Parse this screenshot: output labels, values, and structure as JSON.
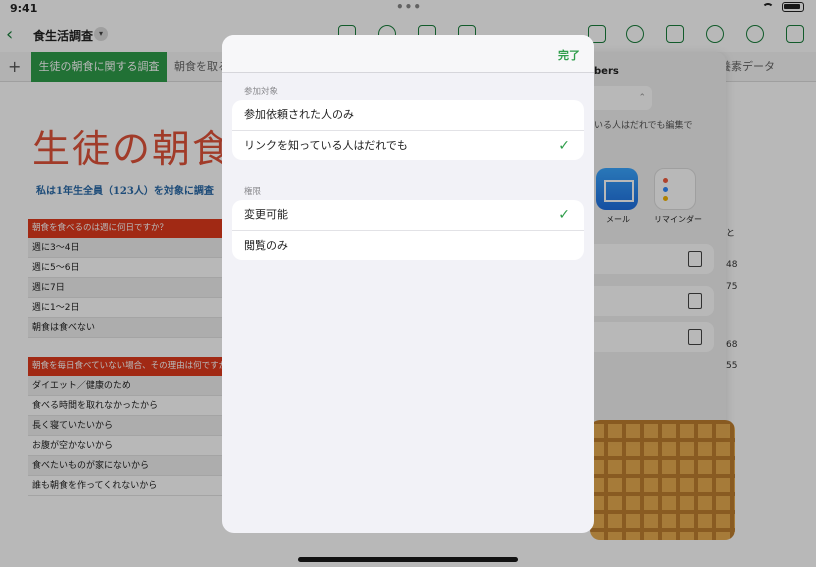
{
  "status_bar": {
    "time": "9:41",
    "dots": "•••"
  },
  "toolbar": {
    "back_icon": "chevron-left-icon",
    "title": "食生活調査",
    "title_menu_icon": "chevron-down-icon"
  },
  "sheet_tabs": {
    "add_label": "+",
    "active": "生徒の朝食に関する調査",
    "second": "朝食を取る",
    "third": "養素データ"
  },
  "document": {
    "heading": "生徒の朝食",
    "subtitle": "私は1年生全員（123人）を対象に調査",
    "table1": {
      "header": "朝食を食べるのは週に何日ですか？",
      "rows": [
        "週に3〜4日",
        "週に5〜6日",
        "週に7日",
        "週に1〜2日",
        "朝食は食べない"
      ]
    },
    "table2": {
      "header": "朝食を毎日食べていない場合、その理由は何ですか",
      "rows": [
        "ダイエット／健康のため",
        "食べる時間を取れなかったから",
        "長く寝ていたいから",
        "お腹が空かないから",
        "食べたいものが家にないから",
        "誰も朝食を作ってくれないから"
      ]
    },
    "right_values": [
      "と",
      "48",
      "75",
      "68",
      "55"
    ]
  },
  "share_panel": {
    "title": "bers",
    "note": "いる人はだれでも編集で",
    "apps": [
      "メール",
      "リマインダー"
    ]
  },
  "modal": {
    "done_label": "完了",
    "audience_label": "参加対象",
    "audience_options": [
      "参加依頼された人のみ",
      "リンクを知っている人はだれでも"
    ],
    "audience_selected": "リンクを知っている人はだれでも",
    "permission_label": "権限",
    "permission_options": [
      "変更可能",
      "閲覧のみ"
    ],
    "permission_selected": "変更可能",
    "check_glyph": "✓",
    "accent_color": "#2e9d4a"
  }
}
